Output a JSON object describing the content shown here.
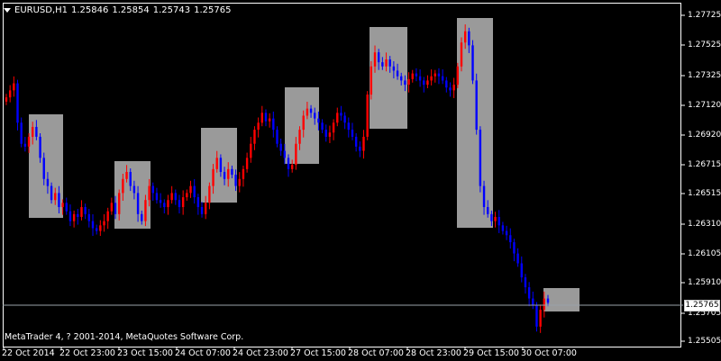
{
  "header": {
    "symbol": "EURUSD,H1",
    "open": "1.25846",
    "high": "1.25854",
    "low": "1.25743",
    "close": "1.25765"
  },
  "copyright": "MetaTrader 4, ? 2001-2014, MetaQuotes Software Corp.",
  "price_tag": "1.25765",
  "colors": {
    "background": "#000000",
    "bull": "#ff0000",
    "bear": "#0000ff",
    "box": "#c0c0c0",
    "axis": "#ffffff"
  },
  "chart_data": {
    "type": "candlestick",
    "y_axis_labels": [
      "1.27725",
      "1.27525",
      "1.27325",
      "1.27120",
      "1.26920",
      "1.26715",
      "1.26515",
      "1.26310",
      "1.26105",
      "1.25910",
      "1.25705",
      "1.25505"
    ],
    "x_axis_labels": [
      "22 Oct 2014",
      "22 Oct 23:00",
      "23 Oct 15:00",
      "24 Oct 07:00",
      "24 Oct 23:00",
      "27 Oct 15:00",
      "28 Oct 07:00",
      "28 Oct 23:00",
      "29 Oct 15:00",
      "30 Oct 07:00"
    ],
    "ylim": [
      1.2549,
      1.2782
    ],
    "current_price": 1.25765,
    "close_series": [
      1.2723,
      1.2728,
      1.2733,
      1.2705,
      1.269,
      1.2688,
      1.2695,
      1.2702,
      1.2695,
      1.268,
      1.2665,
      1.266,
      1.265,
      1.2655,
      1.2645,
      1.2648,
      1.2642,
      1.2635,
      1.264,
      1.2638,
      1.2645,
      1.264,
      1.2635,
      1.263,
      1.2628,
      1.2632,
      1.2635,
      1.2642,
      1.2648,
      1.264,
      1.2655,
      1.2665,
      1.267,
      1.266,
      1.2655,
      1.264,
      1.2635,
      1.265,
      1.266,
      1.2655,
      1.265,
      1.2648,
      1.2645,
      1.265,
      1.2655,
      1.265,
      1.2645,
      1.2652,
      1.2655,
      1.266,
      1.2652,
      1.2645,
      1.264,
      1.2648,
      1.266,
      1.2672,
      1.268,
      1.267,
      1.2665,
      1.2672,
      1.2668,
      1.266,
      1.2665,
      1.2672,
      1.268,
      1.269,
      1.27,
      1.2705,
      1.2712,
      1.2706,
      1.2708,
      1.27,
      1.269,
      1.2685,
      1.268,
      1.2672,
      1.2675,
      1.269,
      1.27,
      1.271,
      1.2715,
      1.2712,
      1.2708,
      1.2705,
      1.27,
      1.2695,
      1.2698,
      1.2705,
      1.2712,
      1.271,
      1.2705,
      1.27,
      1.2695,
      1.2688,
      1.2685,
      1.2695,
      1.2725,
      1.2745,
      1.2755,
      1.2748,
      1.2745,
      1.275,
      1.2745,
      1.2742,
      1.2738,
      1.2735,
      1.2732,
      1.2736,
      1.274,
      1.2738,
      1.2735,
      1.2732,
      1.2735,
      1.2738,
      1.274,
      1.2738,
      1.2735,
      1.273,
      1.2728,
      1.2732,
      1.2745,
      1.2762,
      1.277,
      1.276,
      1.2735,
      1.27,
      1.266,
      1.2645,
      1.264,
      1.2635,
      1.2638,
      1.2632,
      1.2628,
      1.2625,
      1.262,
      1.2612,
      1.2605,
      1.2595,
      1.2588,
      1.258,
      1.2575,
      1.256,
      1.2572,
      1.258,
      1.2577
    ]
  }
}
